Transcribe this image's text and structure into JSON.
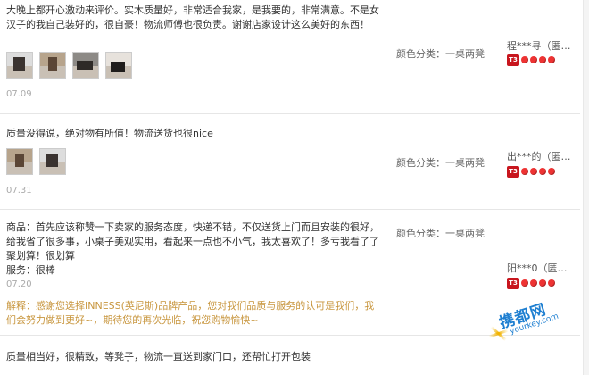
{
  "reviews": [
    {
      "content": "大晚上都开心激动来评价。实木质量好，非常适合我家，是我要的，非常满意。不是女汉子的我自己装好的，很自豪！物流师傅也很负责。谢谢店家设计这么美好的东西！",
      "date": "07.09",
      "sku_label": "颜色分类：",
      "sku_value": "一桌两凳",
      "user": "程***寻（匿…",
      "tier": "T3",
      "hearts": 4,
      "has_images": true
    },
    {
      "content": "质量没得说，绝对物有所值！物流送货也很nice",
      "date": "07.31",
      "sku_label": "颜色分类：",
      "sku_value": "一桌两凳",
      "user": "出***的（匿…",
      "tier": "T3",
      "hearts": 4,
      "has_images": true
    },
    {
      "content": "商品：首先应该称赞一下卖家的服务态度，快递不错，不仅送货上门而且安装的很好，给我省了很多事，小桌子美观实用，看起来一点也不小气，我太喜欢了！多亏我看了了聚划算！很划算",
      "service": "服务：很棒",
      "date": "07.20",
      "sku_label": "颜色分类：",
      "sku_value": "一桌两凳",
      "user": "阳***0（匿…",
      "tier": "T3",
      "hearts": 4,
      "reply_label": "解释：",
      "reply": "感谢您选择INNESS(英尼斯)品牌产品，您对我们品质与服务的认可是我们，我们会努力做到更好~，期待您的再次光临，祝您购物愉快~"
    },
    {
      "content": "质量相当好，很精致，等凳子，物流一直送到家门口，还帮忙打开包装"
    }
  ],
  "watermark": {
    "main": "携都网",
    "sub": "yourkey.com"
  }
}
